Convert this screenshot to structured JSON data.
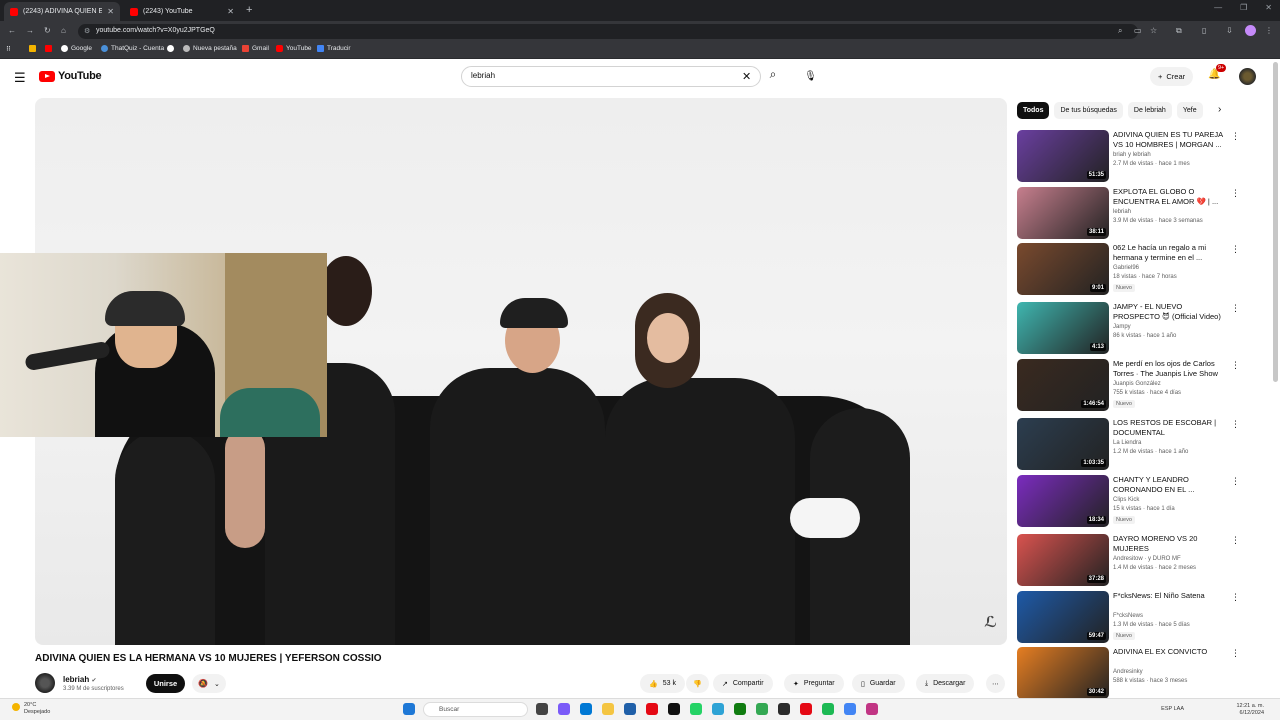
{
  "browser": {
    "tabs": [
      {
        "label": "(2243) ADIVINA QUIEN ES LA H",
        "active": true
      },
      {
        "label": "(2243) YouTube",
        "active": false
      }
    ],
    "url": "youtube.com/watch?v=X0yu2JPTGeQ",
    "bookmarks": [
      "Google",
      "ThatQuiz - Cuenta",
      "Nueva pestaña",
      "Gmail",
      "YouTube",
      "Traducir"
    ]
  },
  "header": {
    "logo_text": "YouTube",
    "search_value": "lebriah",
    "create_label": "Crear",
    "notif_count": "9+"
  },
  "video": {
    "title": "ADIVINA QUIEN ES LA HERMANA VS 10 MUJERES | YEFERSON COSSIO",
    "channel": "lebriah",
    "subscribers": "3.39 M de suscriptores",
    "join_label": "Unirse",
    "actions": {
      "likes": "53 k",
      "share": "Compartir",
      "ask": "Preguntar",
      "save": "Guardar",
      "download": "Descargar"
    }
  },
  "chips": [
    "Todos",
    "De tus búsquedas",
    "De lebriah",
    "Yefe"
  ],
  "recommendations": [
    {
      "title": "ADIVINA QUIEN ES TU PAREJA VS 10 HOMBRES | MORGAN ...",
      "channel": "briah y lebriah",
      "meta": "2.7 M de vistas · hace 1 mes",
      "duration": "51:35",
      "new": "",
      "color": "#6a3fa0"
    },
    {
      "title": "EXPLOTA EL GLOBO O ENCUENTRA EL AMOR 💔 | ...",
      "channel": "lebriah",
      "meta": "3.9 M de vistas · hace 3 semanas",
      "duration": "38:11",
      "new": "",
      "color": "#c77f8e"
    },
    {
      "title": "062 Le hacía un regalo a mi hermana y termine en el ...",
      "channel": "Gabriel96",
      "meta": "18 vistas · hace 7 horas",
      "duration": "9:01",
      "new": "Nuevo",
      "color": "#7a4a2e"
    },
    {
      "title": "JAMPY - EL NUEVO PROSPECTO 😈 (Official Video)",
      "channel": "Jampy",
      "meta": "86 k vistas · hace 1 año",
      "duration": "4:13",
      "new": "",
      "color": "#3fb6b0"
    },
    {
      "title": "Me perdí en los ojos de Carlos Torres · The Juanpis Live Show",
      "channel": "Juanpis González",
      "meta": "755 k vistas · hace 4 días",
      "duration": "1:46:54",
      "new": "Nuevo",
      "color": "#3a2a20"
    },
    {
      "title": "LOS RESTOS DE ESCOBAR | DOCUMENTAL",
      "channel": "La Liendra",
      "meta": "1.2 M de vistas · hace 1 año",
      "duration": "1:03:35",
      "new": "",
      "color": "#2c3e50"
    },
    {
      "title": "CHANTY Y LEANDRO CORONANDO EN EL ...",
      "channel": "Clips Kick",
      "meta": "15 k vistas · hace 1 día",
      "duration": "18:34",
      "new": "Nuevo",
      "color": "#7b2cbf"
    },
    {
      "title": "DAYRO MORENO VS 20 MUJERES",
      "channel": "Andresitow · y DURO MF",
      "meta": "1.4 M de vistas · hace 2 meses",
      "duration": "37:28",
      "new": "",
      "color": "#d9534f"
    },
    {
      "title": "F*cksNews: El Niño Satena",
      "channel": "F*cksNews",
      "meta": "1.3 M de vistas · hace 5 días",
      "duration": "59:47",
      "new": "Nuevo",
      "color": "#1e5aa8"
    },
    {
      "title": "ADIVINA EL EX CONVICTO",
      "channel": "Andresinky",
      "meta": "588 k vistas · hace 3 meses",
      "duration": "30:42",
      "new": "",
      "color": "#e67e22"
    }
  ],
  "taskbar": {
    "weather_temp": "20°C",
    "weather_desc": "Despejado",
    "search_placeholder": "Buscar",
    "lang": "ESP LAA",
    "time": "12:21 a. m.",
    "date": "6/12/2024"
  }
}
